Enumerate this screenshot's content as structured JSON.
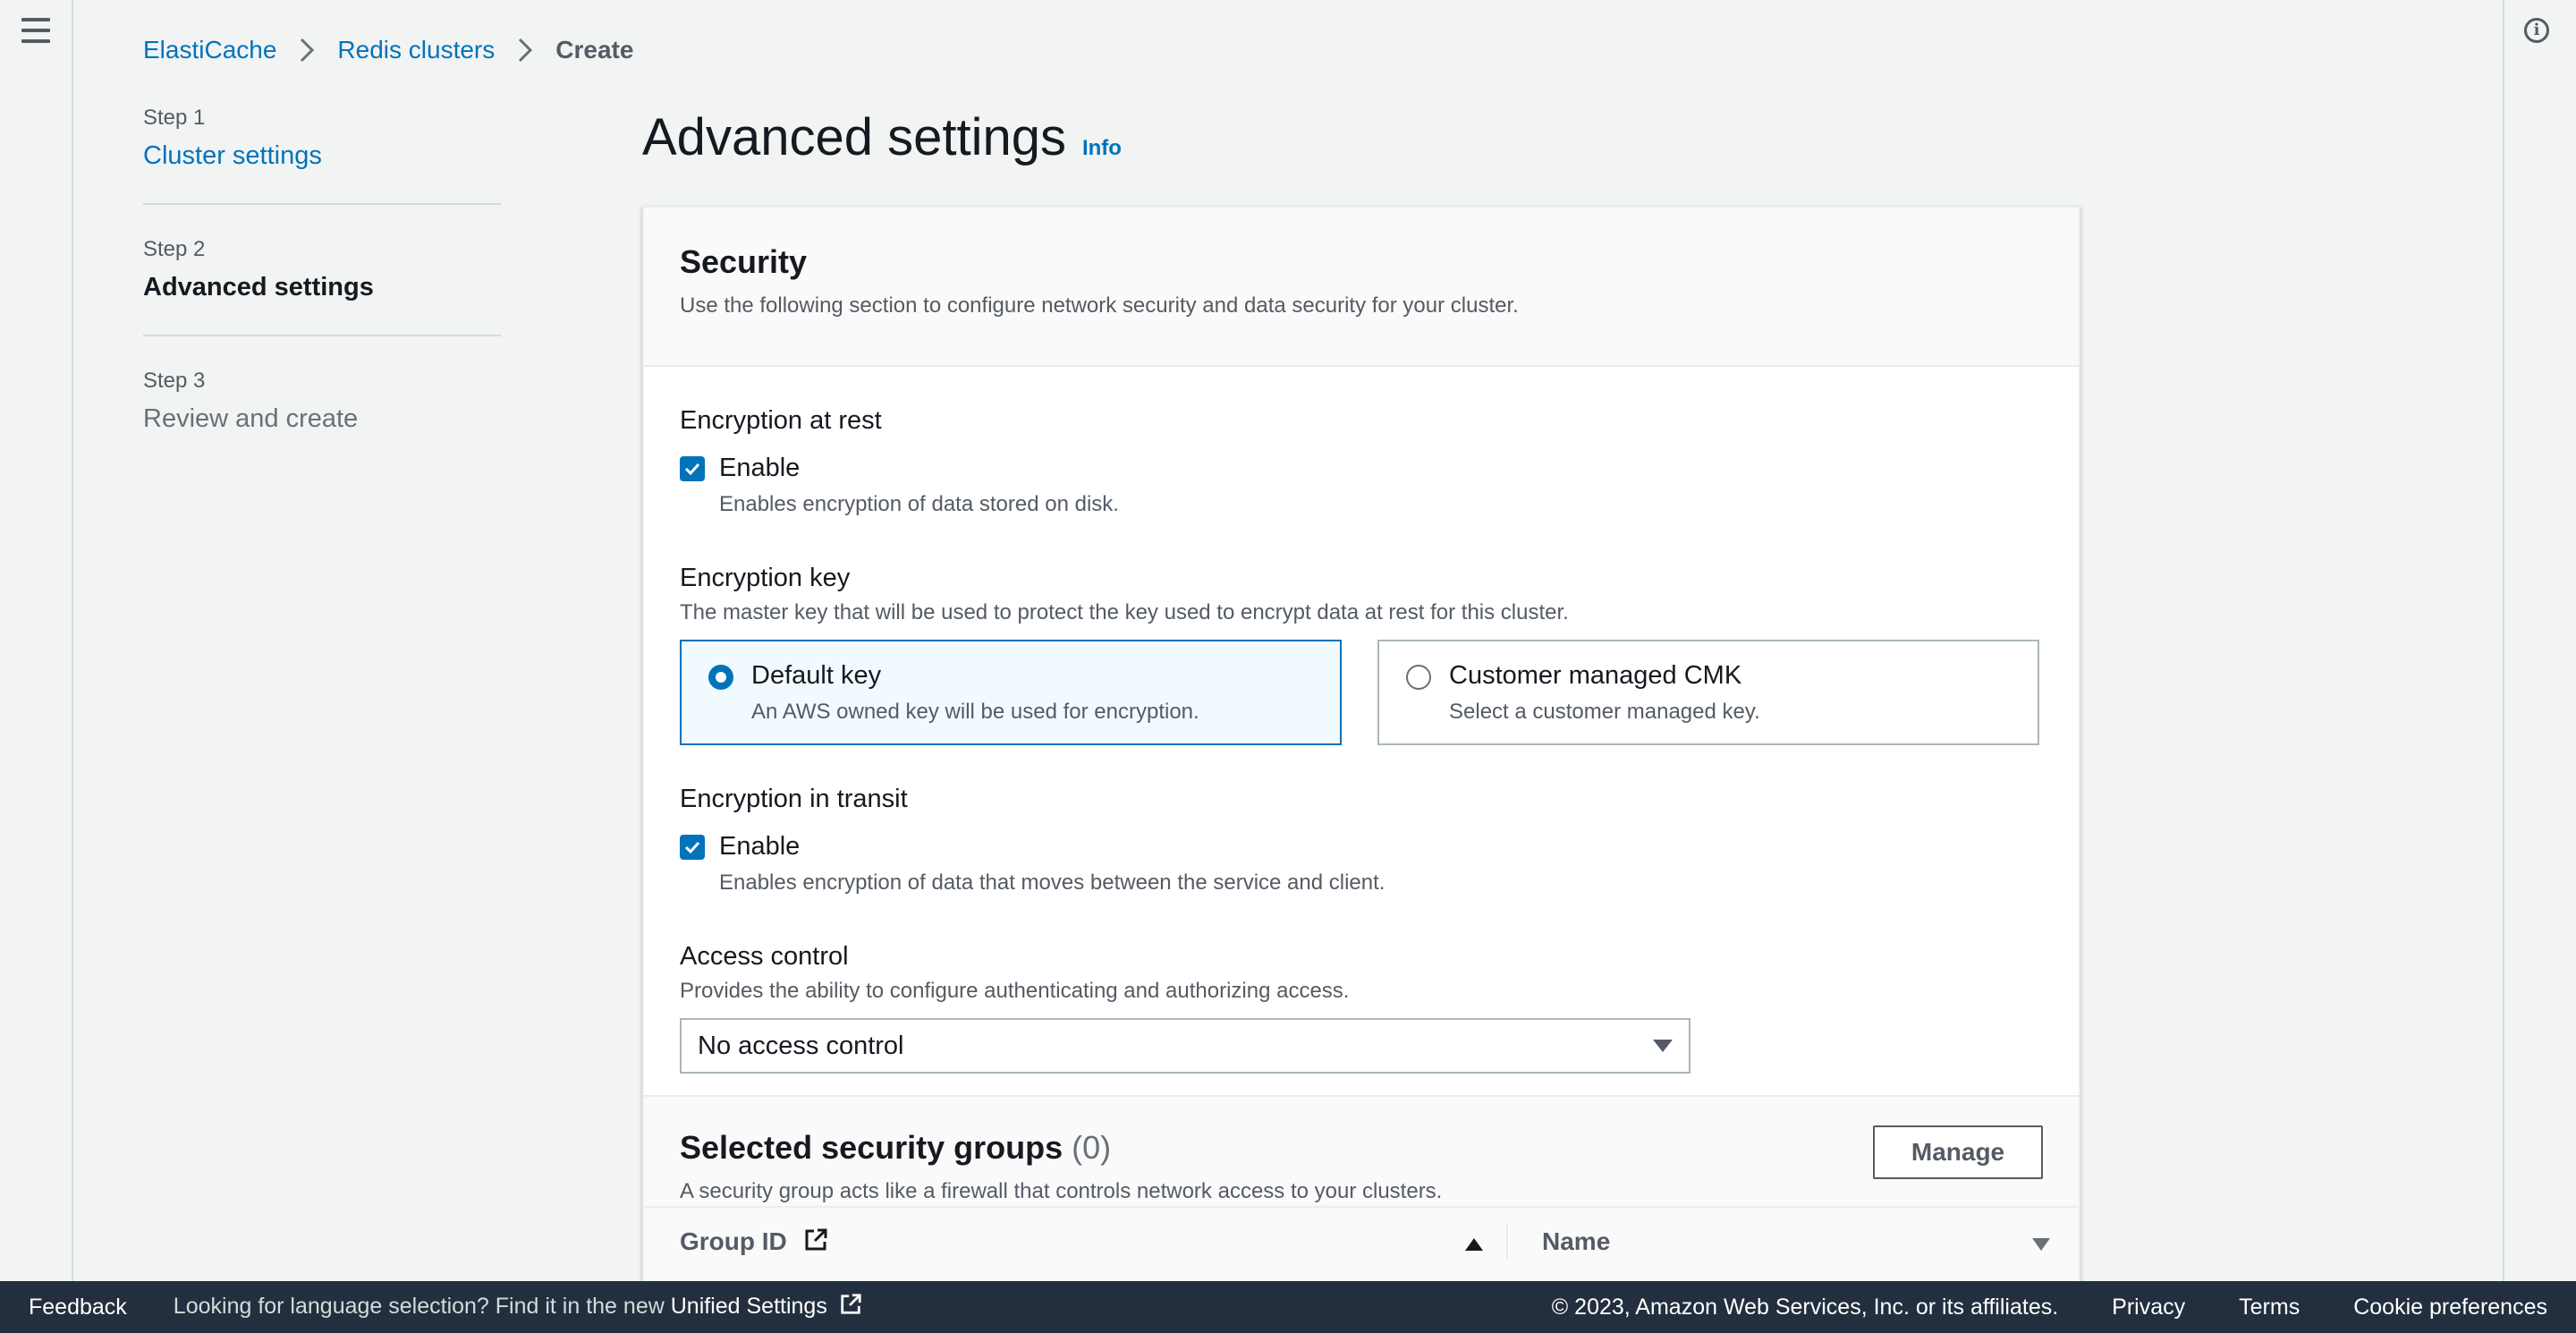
{
  "breadcrumb": {
    "items": [
      "ElastiCache",
      "Redis clusters"
    ],
    "current": "Create"
  },
  "steps": [
    {
      "num": "Step 1",
      "label": "Cluster settings"
    },
    {
      "num": "Step 2",
      "label": "Advanced settings"
    },
    {
      "num": "Step 3",
      "label": "Review and create"
    }
  ],
  "page": {
    "title": "Advanced settings",
    "info": "Info"
  },
  "security": {
    "title": "Security",
    "description": "Use the following section to configure network security and data security for your cluster.",
    "encryption_at_rest": {
      "label": "Encryption at rest",
      "checkbox": "Enable",
      "checked": true,
      "description": "Enables encryption of data stored on disk."
    },
    "encryption_key": {
      "label": "Encryption key",
      "description": "The master key that will be used to protect the key used to encrypt data at rest for this cluster.",
      "options": [
        {
          "title": "Default key",
          "description": "An AWS owned key will be used for encryption.",
          "selected": true
        },
        {
          "title": "Customer managed CMK",
          "description": "Select a customer managed key.",
          "selected": false
        }
      ]
    },
    "encryption_in_transit": {
      "label": "Encryption in transit",
      "checkbox": "Enable",
      "checked": true,
      "description": "Enables encryption of data that moves between the service and client."
    },
    "access_control": {
      "label": "Access control",
      "description": "Provides the ability to configure authenticating and authorizing access.",
      "value": "No access control"
    }
  },
  "security_groups": {
    "title": "Selected security groups",
    "count": "(0)",
    "description": "A security group acts like a firewall that controls network access to your clusters.",
    "manage": "Manage",
    "columns": [
      "Group ID",
      "Name"
    ]
  },
  "footer": {
    "feedback": "Feedback",
    "language_text": "Looking for language selection? Find it in the new",
    "unified_settings": "Unified Settings",
    "copyright": "© 2023, Amazon Web Services, Inc. or its affiliates.",
    "privacy": "Privacy",
    "terms": "Terms",
    "cookies": "Cookie preferences"
  }
}
